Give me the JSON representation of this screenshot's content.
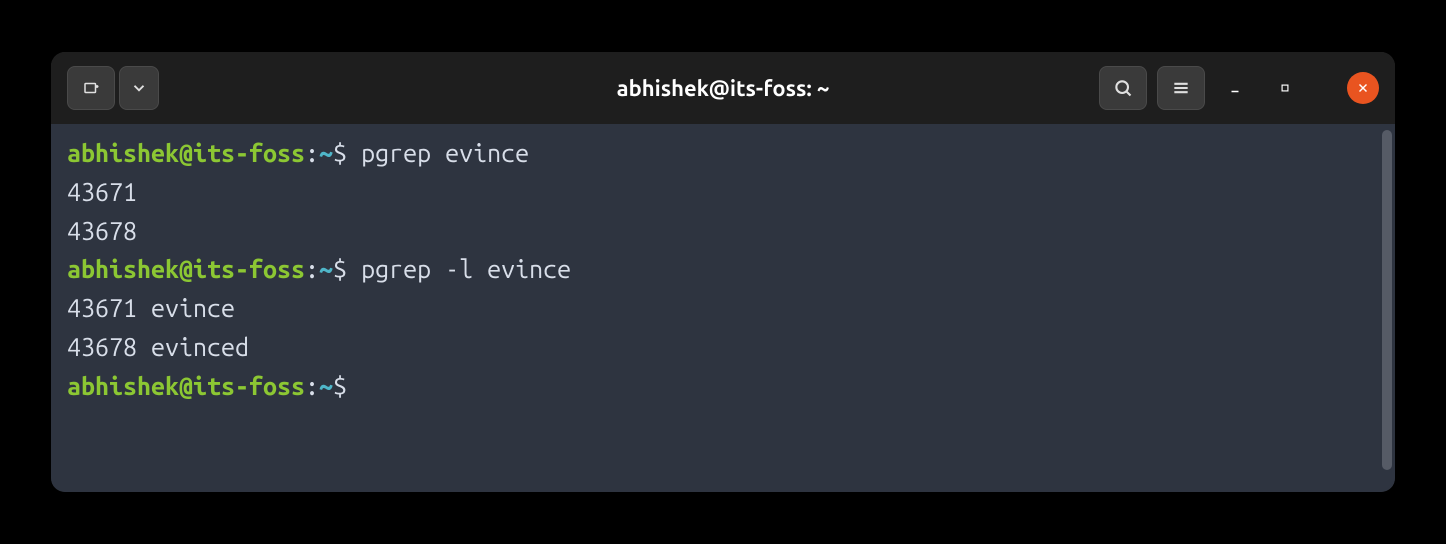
{
  "titlebar": {
    "title": "abhishek@its-foss: ~"
  },
  "prompt": {
    "user_host": "abhishek@its-foss",
    "path": "~",
    "symbol": "$"
  },
  "lines": [
    {
      "type": "prompt",
      "cmd": "pgrep evince"
    },
    {
      "type": "output",
      "text": "43671"
    },
    {
      "type": "output",
      "text": "43678"
    },
    {
      "type": "prompt",
      "cmd": "pgrep -l evince"
    },
    {
      "type": "output",
      "text": "43671 evince"
    },
    {
      "type": "output",
      "text": "43678 evinced"
    },
    {
      "type": "prompt",
      "cmd": ""
    }
  ]
}
